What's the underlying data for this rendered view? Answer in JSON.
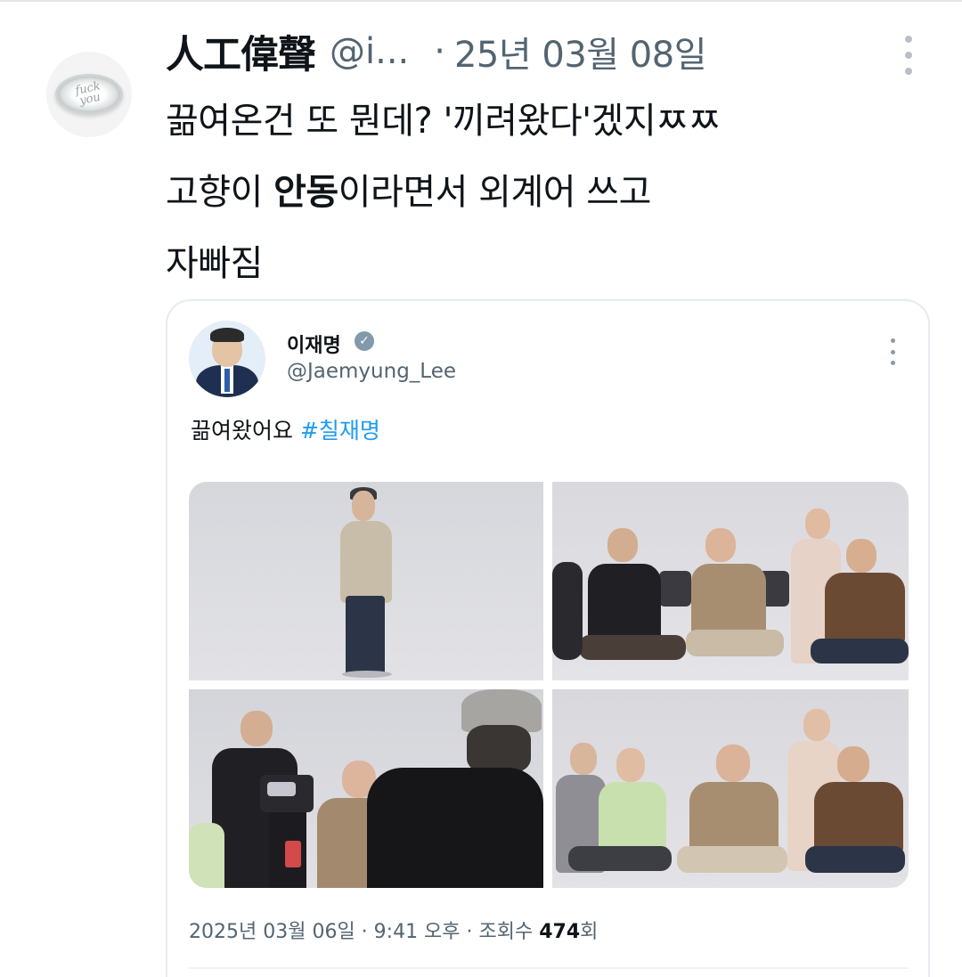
{
  "tweet": {
    "display_name": "人工偉聲",
    "handle": "@i...",
    "separator": "·",
    "date": "25년 03월 08일",
    "text_lines": [
      {
        "normal_before": "끎여온건 또 뭔데? '끼려왔다'겠지ㅉㅉ",
        "bold": "",
        "normal_after": ""
      },
      {
        "normal_before": "고향이 ",
        "bold": "안동",
        "normal_after": "이라면서 외계어 쓰고"
      },
      {
        "normal_before": "자빠짐",
        "bold": "",
        "normal_after": ""
      }
    ],
    "avatar_text_1": "fuck",
    "avatar_text_2": "you"
  },
  "quoted": {
    "name": "이재명",
    "handle": "@Jaemyung_Lee",
    "text": "끎여왔어요",
    "hashtag": "#칠재명",
    "meta_prefix": "2025년 03월 06일 · 9:41 오후 · 조회수 ",
    "views": "474",
    "views_suffix": "회"
  },
  "colors": {
    "text": "#0f1419",
    "secondary": "#536471",
    "link": "#1d9bf0",
    "verified_badge": "#829aab",
    "border": "#e6ebef"
  },
  "icons": {
    "more": "more-vertical-icon",
    "verified": "verified-badge-icon"
  }
}
